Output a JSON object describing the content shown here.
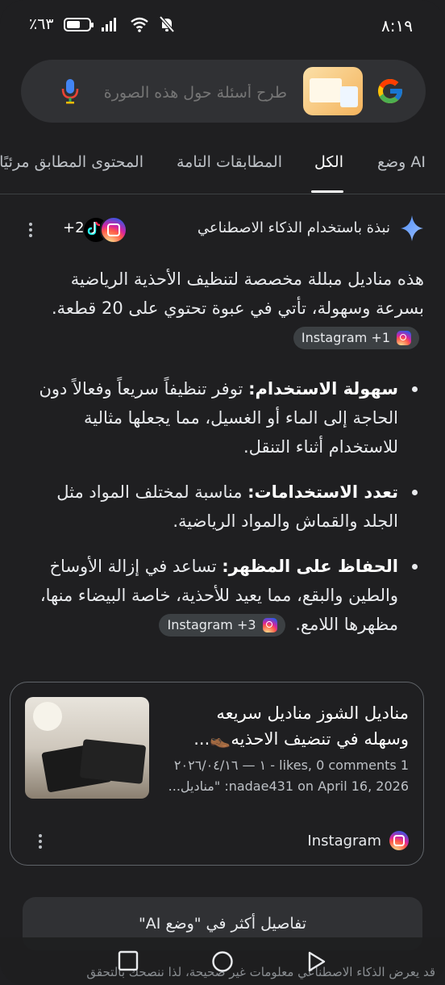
{
  "status_bar": {
    "time": "٨:١٩",
    "battery": "٪٦٣",
    "battery_level": 0.63
  },
  "search": {
    "placeholder": "طرح أسئلة حول هذه الصورة",
    "icons": [
      "google-logo",
      "image-thumbnail",
      "mic-icon"
    ]
  },
  "tabs": [
    {
      "label": "وضع AI"
    },
    {
      "label": "الكل",
      "active": true
    },
    {
      "label": "المطابقات التامة"
    },
    {
      "label": "المحتوى المطابق مرئيًا"
    }
  ],
  "ai_overview": {
    "title": "نبذة باستخدام الذكاء الاصطناعي",
    "source_count": "+2",
    "intro": "هذه مناديل مبللة مخصصة لتنظيف الأحذية الرياضية بسرعة وسهولة، تأتي في عبوة تحتوي على 20 قطعة.",
    "intro_chip": "Instagram +1",
    "bullets": [
      {
        "term": "سهولة الاستخدام:",
        "text": " توفر تنظيفاً سريعاً وفعالاً دون الحاجة إلى الماء أو الغسيل، مما يجعلها مثالية للاستخدام أثناء التنقل."
      },
      {
        "term": "تعدد الاستخدامات:",
        "text": " مناسبة لمختلف المواد مثل الجلد والقماش والمواد الرياضية."
      },
      {
        "term": "الحفاظ على المظهر:",
        "text": " تساعد في إزالة الأوساخ والطين والبقع، مما يعيد للأحذية، خاصة البيضاء منها، مظهرها اللامع."
      }
    ],
    "last_chip": "Instagram +3"
  },
  "card": {
    "title": "مناديل الشوز مناديل سريعه وسهله في تنضيف الاحذيه👞...",
    "meta_line1": "1 likes, 0 comments - ١ — ٢٠٢٦/٠٤/١٦",
    "meta_line2": "nadae431 on April 16, 2026: \"مناديل...",
    "source": "Instagram"
  },
  "more_button": "تفاصيل أكثر في \"وضع AI\"",
  "disclaimer": "قد يعرض الذكاء الاصطناعي معلومات غير صحيحة، لذا ننصحك بالتحقق"
}
